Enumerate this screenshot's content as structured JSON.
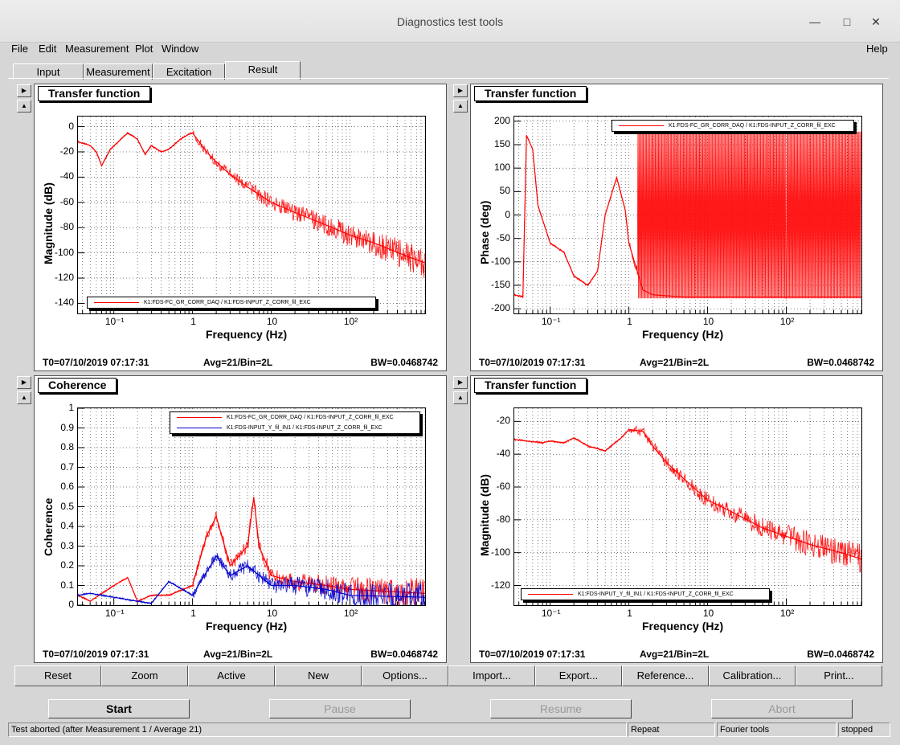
{
  "window": {
    "title": "Diagnostics test tools"
  },
  "menu": {
    "file": "File",
    "edit": "Edit",
    "measurement": "Measurement",
    "plot": "Plot",
    "window": "Window",
    "help": "Help"
  },
  "tabs": [
    "Input",
    "Measurement",
    "Excitation",
    "Result"
  ],
  "panels": [
    {
      "title": "Transfer function",
      "ylabel": "Magnitude (dB)",
      "xlabel": "Frequency (Hz)",
      "yticks": [
        "0",
        "-20",
        "-40",
        "-60",
        "-80",
        "-100",
        "-120",
        "-140"
      ],
      "xticks": [
        "10⁻¹",
        "1",
        "10",
        "10²"
      ],
      "legend": [
        "K1:FDS-FC_GR_CORR_DAQ / K1:FDS-INPUT_Z_CORR_fil_EXC"
      ],
      "t0": "T0=07/10/2019 07:17:31",
      "avg": "Avg=21/Bin=2L",
      "bw": "BW=0.0468742"
    },
    {
      "title": "Transfer function",
      "ylabel": "Phase (deg)",
      "xlabel": "Frequency (Hz)",
      "yticks": [
        "200",
        "150",
        "100",
        "50",
        "0",
        "-50",
        "-100",
        "-150",
        "-200"
      ],
      "xticks": [
        "10⁻¹",
        "1",
        "10",
        "10²"
      ],
      "legend": [
        "K1:FDS-FC_GR_CORR_DAQ / K1:FDS-INPUT_Z_CORR_fil_EXC"
      ],
      "t0": "T0=07/10/2019 07:17:31",
      "avg": "Avg=21/Bin=2L",
      "bw": "BW=0.0468742"
    },
    {
      "title": "Coherence",
      "ylabel": "Coherence",
      "xlabel": "Frequency (Hz)",
      "yticks": [
        "1",
        "0.9",
        "0.8",
        "0.7",
        "0.6",
        "0.5",
        "0.4",
        "0.3",
        "0.2",
        "0.1",
        "0"
      ],
      "xticks": [
        "10⁻¹",
        "1",
        "10",
        "10²"
      ],
      "legend": [
        "K1:FDS-FC_GR_CORR_DAQ / K1:FDS-INPUT_Z_CORR_fil_EXC",
        "K1:FDS-INPUT_Y_fil_IN1 / K1:FDS-INPUT_Z_CORR_fil_EXC"
      ],
      "t0": "T0=07/10/2019 07:17:31",
      "avg": "Avg=21/Bin=2L",
      "bw": "BW=0.0468742"
    },
    {
      "title": "Transfer function",
      "ylabel": "Magnitude (dB)",
      "xlabel": "Frequency (Hz)",
      "yticks": [
        "-20",
        "-40",
        "-60",
        "-80",
        "-100",
        "-120"
      ],
      "xticks": [
        "10⁻¹",
        "1",
        "10",
        "10²"
      ],
      "legend": [
        "K1:FDS-INPUT_Y_fil_IN1 / K1:FDS-INPUT_Z_CORR_fil_EXC"
      ],
      "t0": "T0=07/10/2019 07:17:31",
      "avg": "Avg=21/Bin=2L",
      "bw": "BW=0.0468742"
    }
  ],
  "bottom_buttons": [
    "Reset",
    "Zoom",
    "Active",
    "New",
    "Options...",
    "Import...",
    "Export...",
    "Reference...",
    "Calibration...",
    "Print..."
  ],
  "control_buttons": {
    "start": "Start",
    "pause": "Pause",
    "resume": "Resume",
    "abort": "Abort"
  },
  "status": {
    "message": "Test aborted (after Measurement 1 / Average 21)",
    "repeat": "Repeat",
    "tool": "Fourier tools",
    "state": "stopped"
  },
  "colors": {
    "series1": "#ff0000",
    "series2": "#0000cc",
    "window_bg": "#d6d6d6"
  },
  "chart_data": [
    {
      "type": "line",
      "title": "Transfer function",
      "xlabel": "Frequency (Hz)",
      "ylabel": "Magnitude (dB)",
      "xscale": "log",
      "xlim": [
        0.035,
        900
      ],
      "ylim": [
        -148,
        8
      ],
      "grid": true,
      "legend_position": "bottom-center",
      "series": [
        {
          "name": "K1:FDS-FC_GR_CORR_DAQ / K1:FDS-INPUT_Z_CORR_fil_EXC",
          "x": [
            0.035,
            0.05,
            0.06,
            0.07,
            0.09,
            0.15,
            0.2,
            0.25,
            0.3,
            0.4,
            0.5,
            0.7,
            0.9,
            1,
            1.5,
            2,
            3,
            5,
            10,
            20,
            50,
            100,
            200,
            500,
            900
          ],
          "y": [
            -12,
            -15,
            -20,
            -31,
            -18,
            -5,
            -10,
            -22,
            -15,
            -20,
            -18,
            -10,
            -6,
            -5,
            -20,
            -28,
            -38,
            -48,
            -60,
            -68,
            -78,
            -86,
            -92,
            -102,
            -108
          ]
        }
      ]
    },
    {
      "type": "line",
      "title": "Transfer function",
      "xlabel": "Frequency (Hz)",
      "ylabel": "Phase (deg)",
      "xscale": "log",
      "xlim": [
        0.035,
        900
      ],
      "ylim": [
        -210,
        210
      ],
      "grid": true,
      "legend_position": "top-right",
      "series": [
        {
          "name": "K1:FDS-FC_GR_CORR_DAQ / K1:FDS-INPUT_Z_CORR_fil_EXC",
          "x": [
            0.035,
            0.045,
            0.05,
            0.06,
            0.07,
            0.1,
            0.15,
            0.2,
            0.3,
            0.4,
            0.5,
            0.7,
            0.9,
            1,
            1.5,
            2,
            5,
            10,
            100,
            900
          ],
          "y": [
            -170,
            -175,
            170,
            140,
            20,
            -60,
            -80,
            -130,
            -150,
            -120,
            0,
            80,
            10,
            -60,
            -160,
            -170,
            -175,
            -175,
            -175,
            -175
          ]
        }
      ]
    },
    {
      "type": "line",
      "title": "Coherence",
      "xlabel": "Frequency (Hz)",
      "ylabel": "Coherence",
      "xscale": "log",
      "xlim": [
        0.035,
        900
      ],
      "ylim": [
        0,
        1
      ],
      "grid": true,
      "legend_position": "top-right",
      "series": [
        {
          "name": "K1:FDS-FC_GR_CORR_DAQ / K1:FDS-INPUT_Z_CORR_fil_EXC",
          "x": [
            0.035,
            0.05,
            0.1,
            0.15,
            0.2,
            0.3,
            0.5,
            1,
            1.5,
            2,
            3,
            5,
            6,
            7,
            10,
            20,
            50,
            100,
            900
          ],
          "y": [
            0.05,
            0.02,
            0.1,
            0.14,
            0.02,
            0.05,
            0.05,
            0.1,
            0.35,
            0.45,
            0.2,
            0.3,
            0.55,
            0.3,
            0.15,
            0.12,
            0.1,
            0.08,
            0.06
          ]
        },
        {
          "name": "K1:FDS-INPUT_Y_fil_IN1 / K1:FDS-INPUT_Z_CORR_fil_EXC",
          "x": [
            0.035,
            0.05,
            0.1,
            0.2,
            0.3,
            0.5,
            1,
            2,
            3,
            5,
            10,
            20,
            50,
            100,
            900
          ],
          "y": [
            0.05,
            0.06,
            0.04,
            0.02,
            0.01,
            0.12,
            0.05,
            0.25,
            0.15,
            0.2,
            0.1,
            0.1,
            0.08,
            0.05,
            0.04
          ]
        }
      ]
    },
    {
      "type": "line",
      "title": "Transfer function",
      "xlabel": "Frequency (Hz)",
      "ylabel": "Magnitude (dB)",
      "xscale": "log",
      "xlim": [
        0.035,
        900
      ],
      "ylim": [
        -132,
        -12
      ],
      "grid": true,
      "legend_position": "bottom-left",
      "series": [
        {
          "name": "K1:FDS-INPUT_Y_fil_IN1 / K1:FDS-INPUT_Z_CORR_fil_EXC",
          "x": [
            0.035,
            0.05,
            0.08,
            0.1,
            0.15,
            0.2,
            0.3,
            0.5,
            0.8,
            1,
            1.5,
            2,
            3,
            5,
            10,
            20,
            50,
            100,
            200,
            500,
            900
          ],
          "y": [
            -31,
            -32,
            -33,
            -32,
            -33,
            -30,
            -35,
            -38,
            -30,
            -25,
            -26,
            -35,
            -45,
            -55,
            -68,
            -75,
            -85,
            -90,
            -95,
            -100,
            -104
          ]
        }
      ]
    }
  ]
}
